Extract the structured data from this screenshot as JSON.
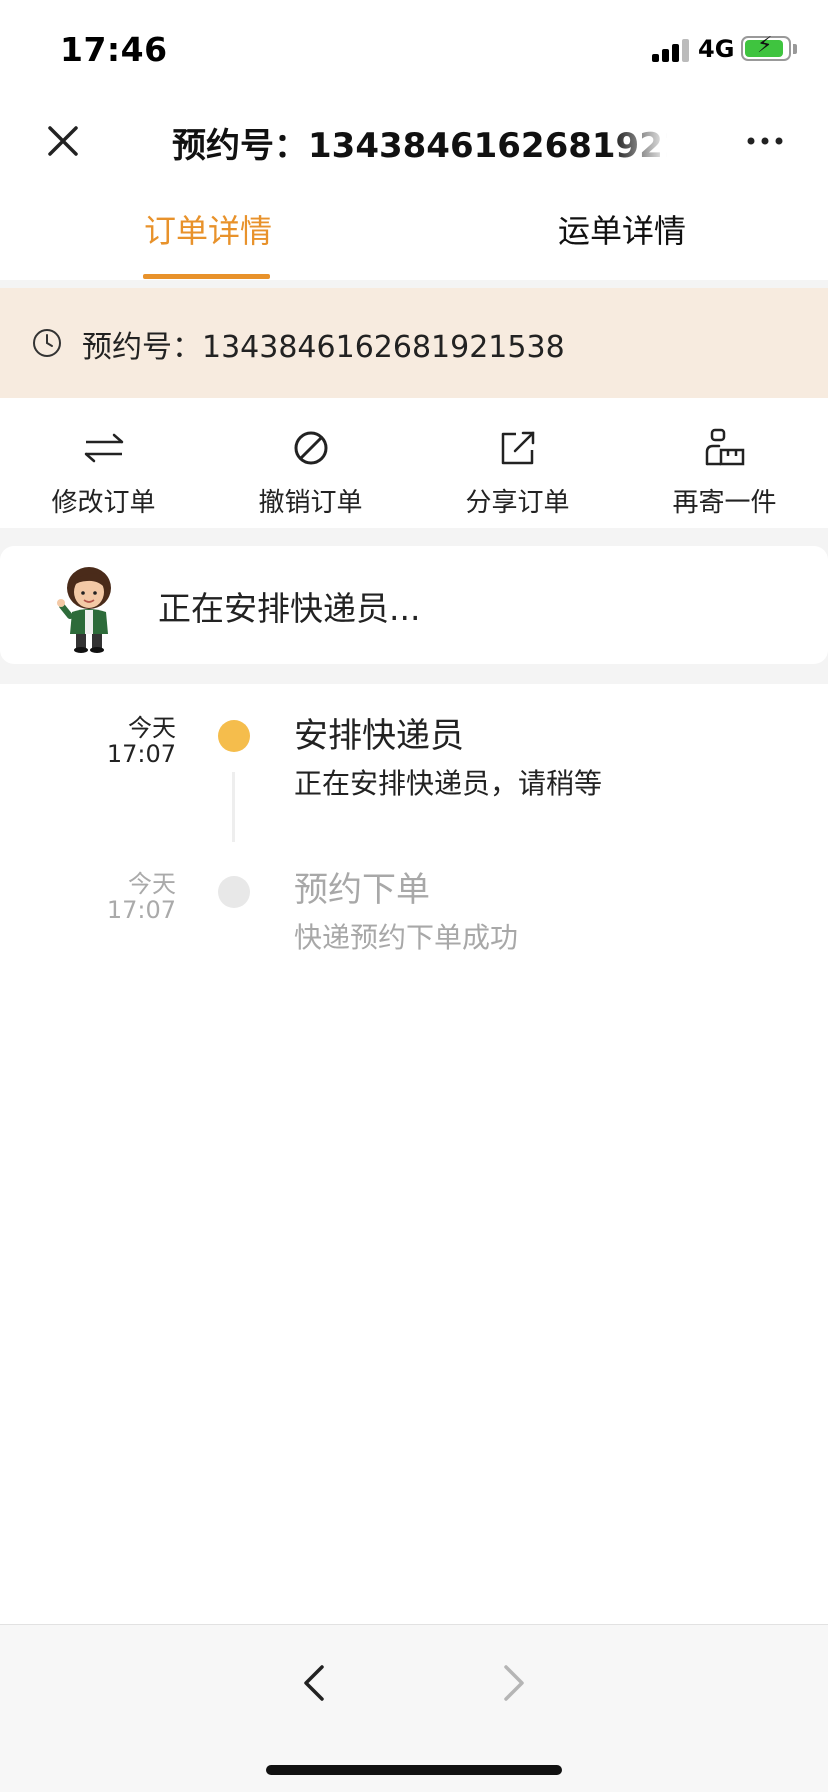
{
  "status_bar": {
    "time": "17:46",
    "network": "4G",
    "battery_charging": true,
    "battery_level": 0.85,
    "signal_bars": 3
  },
  "navbar": {
    "title": "预约号：1343846162681921538",
    "close_icon": "close-icon",
    "more_icon": "more-icon"
  },
  "tabs": [
    {
      "label": "订单详情",
      "active": true
    },
    {
      "label": "运单详情",
      "active": false
    }
  ],
  "order": {
    "label": "预约号：1343846162681921538",
    "icon": "clock-icon"
  },
  "actions": [
    {
      "label": "修改订单",
      "icon": "swap-icon"
    },
    {
      "label": "撤销订单",
      "icon": "cancel-icon"
    },
    {
      "label": "分享订单",
      "icon": "share-icon"
    },
    {
      "label": "再寄一件",
      "icon": "send-package-icon"
    }
  ],
  "courier": {
    "status_text": "正在安排快递员..."
  },
  "timeline": [
    {
      "day": "今天",
      "time": "17:07",
      "title": "安排快递员",
      "desc": "正在安排快递员，请稍等",
      "active": true
    },
    {
      "day": "今天",
      "time": "17:07",
      "title": "预约下单",
      "desc": "快递预约下单成功",
      "active": false
    }
  ],
  "colors": {
    "accent": "#e8922b",
    "banner_bg": "#f7ebdf",
    "active_dot": "#f5bd4c",
    "inactive_dot": "#e8e8e8"
  },
  "bottom_bar": {
    "back_icon": "chevron-left-icon",
    "forward_icon": "chevron-right-icon"
  }
}
